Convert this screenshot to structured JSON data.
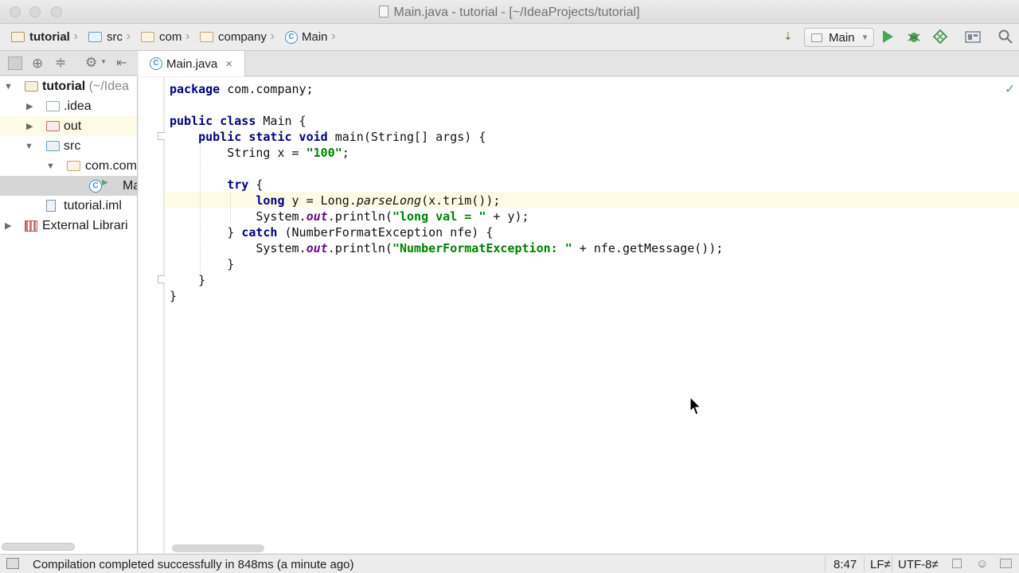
{
  "window": {
    "title": "Main.java - tutorial - [~/IdeaProjects/tutorial]"
  },
  "breadcrumbs": [
    {
      "label": "tutorial",
      "icon": "project-folder-icon"
    },
    {
      "label": "src",
      "icon": "source-folder-icon"
    },
    {
      "label": "com",
      "icon": "package-folder-icon"
    },
    {
      "label": "company",
      "icon": "package-folder-icon"
    },
    {
      "label": "Main",
      "icon": "class-icon"
    }
  ],
  "toolbar": {
    "run_config": "Main"
  },
  "project_tree": {
    "items": [
      {
        "label": "tutorial",
        "suffix": " (~/Idea",
        "expanded": true
      },
      {
        "label": ".idea",
        "expanded": false
      },
      {
        "label": "out",
        "expanded": false
      },
      {
        "label": "src",
        "expanded": true
      },
      {
        "label": "com.com",
        "expanded": true
      },
      {
        "label": "Ma",
        "selected": true
      },
      {
        "label": "tutorial.iml"
      },
      {
        "label": "External Librari",
        "expanded": false
      }
    ]
  },
  "editor": {
    "tab_label": "Main.java",
    "code": {
      "l1_kw": "package",
      "l1_rest": " com.company;",
      "l3_kw": "public class",
      "l3_rest": " Main {",
      "l4_kw": "public static void",
      "l4_rest": " main(String[] args) {",
      "l5_a": "String x = ",
      "l5_str": "\"100\"",
      "l5_b": ";",
      "l7_kw": "try",
      "l7_rest": " {",
      "l8_kw": "long",
      "l8_a": " y = Long.",
      "l8_it": "parseLong",
      "l8_b": "(x.trim());",
      "l9_a": "System.",
      "l9_st": "out",
      "l9_b": ".println(",
      "l9_str": "\"long val = \"",
      "l9_c": " + y);",
      "l10_a": "} ",
      "l10_kw": "catch",
      "l10_b": " (NumberFormatException nfe) {",
      "l11_a": "System.",
      "l11_st": "out",
      "l11_b": ".println(",
      "l11_str": "\"NumberFormatException: \"",
      "l11_c": " + nfe.getMessage());",
      "l12": "}",
      "l13": "}",
      "l14": "}"
    }
  },
  "status_bar": {
    "message": "Compilation completed successfully in 848ms (a minute ago)",
    "position": "8:47",
    "line_separator": "LF≠",
    "encoding": "UTF-8≠"
  }
}
